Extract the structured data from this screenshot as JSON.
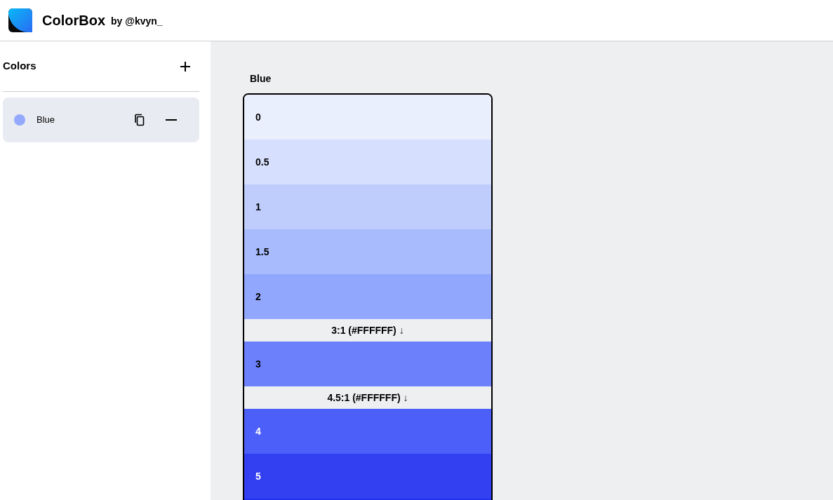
{
  "header": {
    "app_name": "ColorBox",
    "byline": "by @kvyn_"
  },
  "sidebar": {
    "title": "Colors",
    "items": [
      {
        "name": "Blue",
        "color": "#94a8fd",
        "selected": true
      }
    ]
  },
  "palette": {
    "title": "Blue",
    "rows": [
      {
        "kind": "swatch",
        "label": "0",
        "color": "#eaeffe",
        "light_label": false
      },
      {
        "kind": "swatch",
        "label": "0.5",
        "color": "#d6e0fe",
        "light_label": false
      },
      {
        "kind": "swatch",
        "label": "1",
        "color": "#bfcdfd",
        "light_label": false
      },
      {
        "kind": "swatch",
        "label": "1.5",
        "color": "#a7bbfd",
        "light_label": false
      },
      {
        "kind": "swatch",
        "label": "2",
        "color": "#91a7fd",
        "light_label": false
      },
      {
        "kind": "contrast",
        "label": "3:1 (#FFFFFF)",
        "arrow": "↓"
      },
      {
        "kind": "swatch",
        "label": "3",
        "color": "#6d80fb",
        "light_label": false
      },
      {
        "kind": "contrast",
        "label": "4.5:1 (#FFFFFF)",
        "arrow": "↓"
      },
      {
        "kind": "swatch",
        "label": "4",
        "color": "#4c5ff8",
        "light_label": true
      },
      {
        "kind": "swatch",
        "label": "5",
        "color": "#3340f2",
        "light_label": true
      },
      {
        "kind": "swatch",
        "color": "#2131ee"
      }
    ]
  }
}
